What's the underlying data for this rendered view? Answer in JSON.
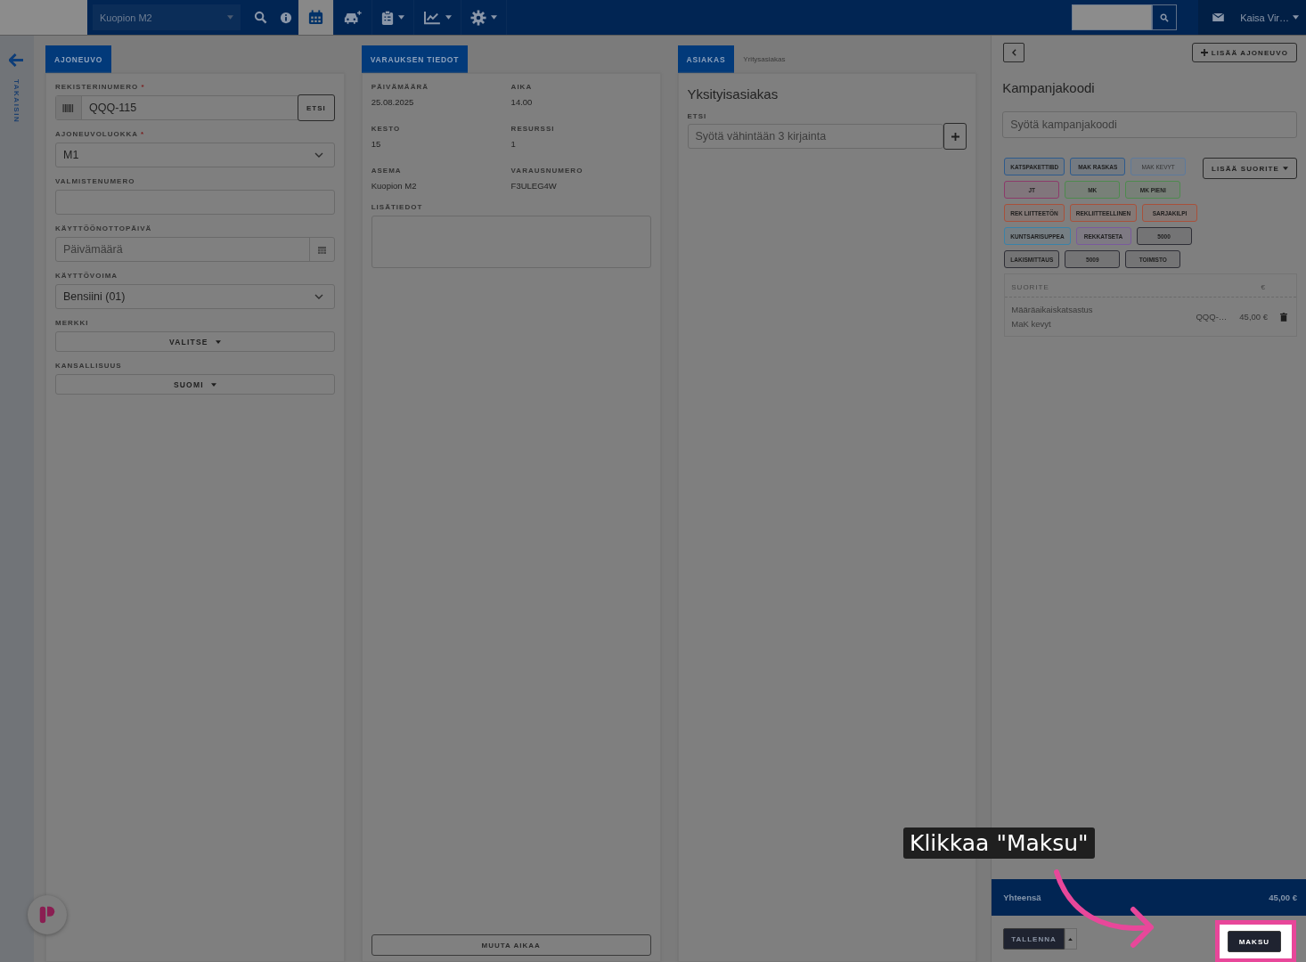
{
  "topbar": {
    "station": "Kuopion M2",
    "nav": [
      {
        "kind": "search",
        "dropdown": false,
        "selected": false
      },
      {
        "kind": "info",
        "dropdown": false,
        "selected": false
      },
      {
        "kind": "calendar",
        "dropdown": false,
        "selected": true
      },
      {
        "kind": "car",
        "dropdown": false,
        "selected": false
      },
      {
        "kind": "clipboard",
        "dropdown": true,
        "selected": false
      },
      {
        "kind": "chart",
        "dropdown": true,
        "selected": false
      },
      {
        "kind": "gear",
        "dropdown": true,
        "selected": false
      }
    ],
    "user": "Kaisa Vir…"
  },
  "back_label": "TAKAISIN",
  "vehicle": {
    "tab": "AJONEUVO",
    "fields": [
      {
        "kind": "addon",
        "label": "REKISTERINUMERO",
        "required_mark": "*",
        "value": "QQQ-115",
        "button": "ETSI"
      },
      {
        "kind": "select",
        "label": "AJONEUVOLUOKKA",
        "required_mark": "*",
        "value": "M1"
      },
      {
        "kind": "text",
        "label": "VALMISTENUMERO"
      },
      {
        "kind": "date",
        "label": "KÄYTTÖÖNOTTOPÄIVÄ",
        "placeholder": "Päivämäärä"
      },
      {
        "kind": "select",
        "label": "KÄYTTÖVOIMA",
        "value": "Bensiini (01)"
      },
      {
        "kind": "dropdown",
        "label": "MERKKI",
        "value": "VALITSE"
      },
      {
        "kind": "dropdown",
        "label": "KANSALLISUUS",
        "value": "SUOMI"
      }
    ]
  },
  "booking": {
    "tab": "VARAUKSEN TIEDOT",
    "items": [
      {
        "label": "PÄIVÄMÄÄRÄ",
        "value": "25.08.2025"
      },
      {
        "label": "AIKA",
        "value": "14.00"
      },
      {
        "label": "KESTO",
        "value": "15"
      },
      {
        "label": "RESURSSI",
        "value": "1"
      },
      {
        "label": "ASEMA",
        "value": "Kuopion M2"
      },
      {
        "label": "VARAUSNUMERO",
        "value": "F3ULEG4W"
      }
    ],
    "notes_label": "LISÄTIEDOT",
    "button": "MUUTA AIKAA"
  },
  "customer": {
    "tabs": [
      {
        "label": "ASIAKAS",
        "selected": true
      },
      {
        "label": "Yritysasiakas",
        "selected": false
      }
    ],
    "heading": "Yksityisasiakas",
    "search_label": "ETSI",
    "placeholder": "Syötä vähintään 3 kirjainta"
  },
  "cart": {
    "add_vehicle": "LISÄÄ AJONEUVO",
    "campaign_heading": "Kampanjakoodi",
    "campaign_placeholder": "Syötä kampanjakoodi",
    "add_service": "LISÄÄ SUORITE",
    "tags": [
      [
        {
          "label": "KATSPAKETTIBD",
          "color": "#2d5a8c",
          "disabled": false
        },
        {
          "label": "MAK RASKAS",
          "color": "#2d5a8c",
          "disabled": false
        },
        {
          "label": "MAK KEVYT",
          "color": "#5d7a9c",
          "disabled": true
        }
      ],
      [
        {
          "label": "JT",
          "color": "#8c3a6a",
          "disabled": false
        },
        {
          "label": "MK",
          "color": "#4e8a4e",
          "disabled": false
        },
        {
          "label": "MK PIENI",
          "color": "#4e8a4e",
          "disabled": false
        }
      ],
      [
        {
          "label": "REK LIITTEETÖN",
          "color": "#a8503a",
          "disabled": false
        },
        {
          "label": "REKLIITTEELLINEN",
          "color": "#a8503a",
          "disabled": false
        },
        {
          "label": "SARJAKILPI",
          "color": "#a8503a",
          "disabled": false
        }
      ],
      [
        {
          "label": "KUNTSARISUPPEA",
          "color": "#3a82a8",
          "disabled": false
        },
        {
          "label": "REKKATSETA",
          "color": "#7a5a9c",
          "disabled": false
        },
        {
          "label": "5000",
          "color": "#2e2e36",
          "disabled": false
        }
      ],
      [
        {
          "label": "LAKISMITTAUS",
          "color": "#2e2e36",
          "disabled": false
        },
        {
          "label": "5009",
          "color": "#2e2e36",
          "disabled": false
        },
        {
          "label": "TOIMISTO",
          "color": "#2e2e36",
          "disabled": false
        }
      ]
    ],
    "table": {
      "columns": [
        "SUORITE",
        "€"
      ],
      "rows": [
        {
          "service": "Määräaikaiskatsastus",
          "subtitle": "MaK kevyt",
          "vehicle": "QQQ-…",
          "price": "45,00 €"
        }
      ]
    },
    "total_label": "Yhteensä",
    "total": "45,00 €",
    "save": "TALLENNA",
    "pay": "MAKSU"
  },
  "callout": "Klikkaa \"Maksu\""
}
